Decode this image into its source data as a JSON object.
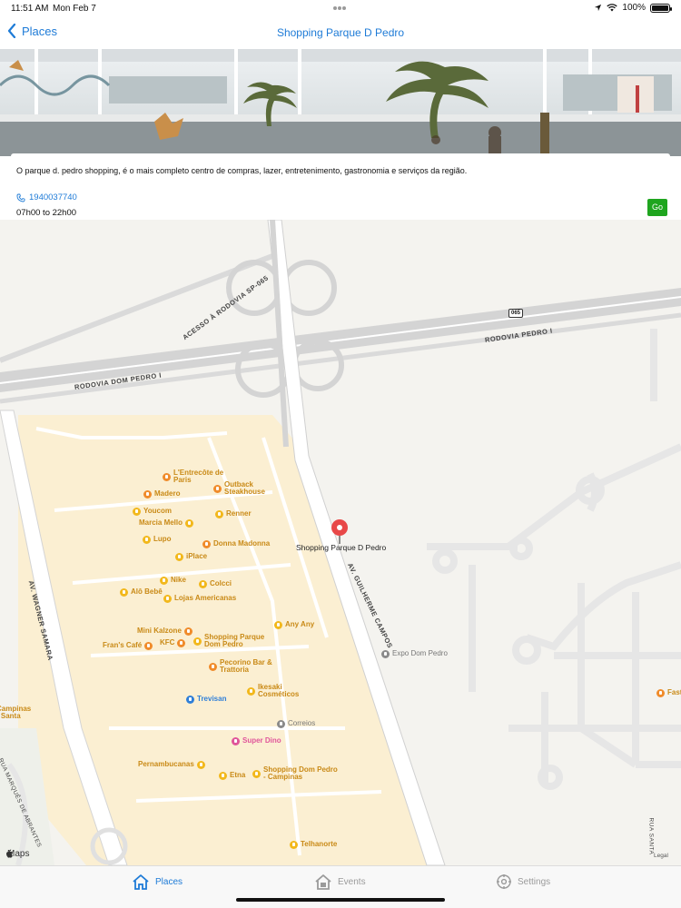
{
  "status_bar": {
    "time": "11:51 AM",
    "date": "Mon Feb 7",
    "battery": "100%",
    "battery_level": 1.0
  },
  "nav": {
    "back_label": "Places",
    "title": "Shopping Parque D Pedro"
  },
  "place": {
    "description": "O parque d. pedro shopping, é o mais completo centro de compras, lazer, entretenimento, gastronomia e serviços da região.",
    "phone": "1940037740",
    "hours": "07h00 to 22h00",
    "go_label": "Go"
  },
  "map": {
    "pin_label": "Shopping Parque D Pedro",
    "roads": {
      "acesso": "ACESSO À RODOVIA SP-065",
      "dom_pedro_i": "RODOVIA DOM PEDRO I",
      "pedro_i": "RODOVIA PEDRO I",
      "guilherme": "AV. GUILHERME CAMPOS",
      "wagner": "AV. WAGNER SAMARA",
      "marques": "RUA MARQUÊS DE ABRANTES",
      "santa": "RUA SANTA",
      "shield": "065"
    },
    "pois": {
      "entrecote": "L'Entrecôte de Paris",
      "outback": "Outback Steakhouse",
      "madero": "Madero",
      "youcom": "Youcom",
      "renner": "Renner",
      "marcia": "Marcia Mello",
      "lupo": "Lupo",
      "donna": "Donna Madonna",
      "iplace": "iPlace",
      "nike": "Nike",
      "colcci": "Colcci",
      "alo": "Alô Bebê",
      "lojas": "Lojas Americanas",
      "anyany": "Any Any",
      "kalzone": "Mini Kalzone",
      "kfc": "KFC",
      "shopping_dp": "Shopping Parque Dom Pedro",
      "frans": "Fran's Café",
      "pecorino": "Pecorino Bar & Trattoria",
      "ikesaki": "Ikesaki Cosméticos",
      "trevisan": "Trevisan",
      "correios": "Correios",
      "expo": "Expo Dom Pedro",
      "superdino": "Super Dino",
      "pernambucanas": "Pernambucanas",
      "etna": "Etna",
      "shopping_dpc": "Shopping Dom Pedro - Campinas",
      "telhanorte": "Telhanorte",
      "campinas": "Campinas - Santa",
      "fast": "Fast"
    },
    "maps_label": "Maps",
    "legal_label": "Legal"
  },
  "tabs": [
    {
      "label": "Places",
      "icon": "house-icon",
      "active": true
    },
    {
      "label": "Events",
      "icon": "house-calendar-icon",
      "active": false
    },
    {
      "label": "Settings",
      "icon": "gear-icon",
      "active": false
    }
  ],
  "colors": {
    "accent": "#1e7bd7",
    "go": "#1fa51f",
    "pin": "#e84848",
    "mall_area": "#fbefd2",
    "poi": "#c98a17"
  }
}
